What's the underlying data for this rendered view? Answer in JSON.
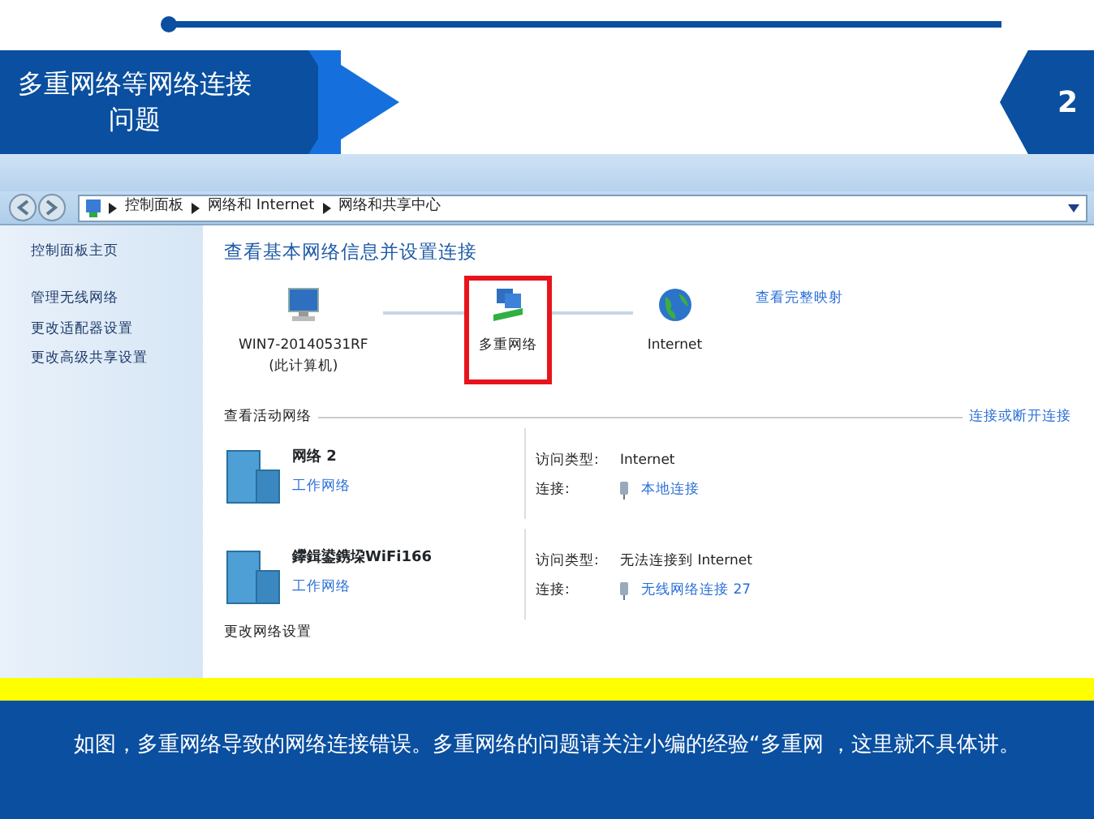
{
  "slide": {
    "title": "多重网络等网络连接问题",
    "page_number": "2"
  },
  "window": {
    "breadcrumb": [
      "控制面板",
      "网络和 Internet",
      "网络和共享中心"
    ]
  },
  "sidebar": {
    "items": [
      {
        "label": "控制面板主页"
      },
      {
        "label": "管理无线网络"
      },
      {
        "label": "更改适配器设置"
      },
      {
        "label": "更改高级共享设置"
      }
    ]
  },
  "main": {
    "heading": "查看基本网络信息并设置连接",
    "full_map_link": "查看完整映射",
    "nodes": [
      {
        "kind": "computer",
        "label": "WIN7-20140531RF",
        "sublabel": "(此计算机)",
        "highlighted": false
      },
      {
        "kind": "network",
        "label": "多重网络",
        "highlighted": true
      },
      {
        "kind": "internet",
        "label": "Internet",
        "highlighted": false
      }
    ],
    "active_networks": {
      "title": "查看活动网络",
      "link": "连接或断开连接",
      "networks": [
        {
          "name": "网络  2",
          "category": "工作网络",
          "access_label": "访问类型:",
          "access": "Internet",
          "connection_label": "连接:",
          "connection": "本地连接"
        },
        {
          "name": "鑻鍓鍙鎸垜WiFi166",
          "category": "工作网络",
          "access_label": "访问类型:",
          "access": "无法连接到 Internet",
          "connection_label": "连接:",
          "connection": "无线网络连接 27"
        }
      ]
    },
    "footer_link": "更改网络设置"
  },
  "caption": {
    "parts": [
      "如图，多重网络导致的网络连接错误。多重网络的问题请关注小编的经验“多重网",
      "，这里就不具体讲。"
    ]
  }
}
